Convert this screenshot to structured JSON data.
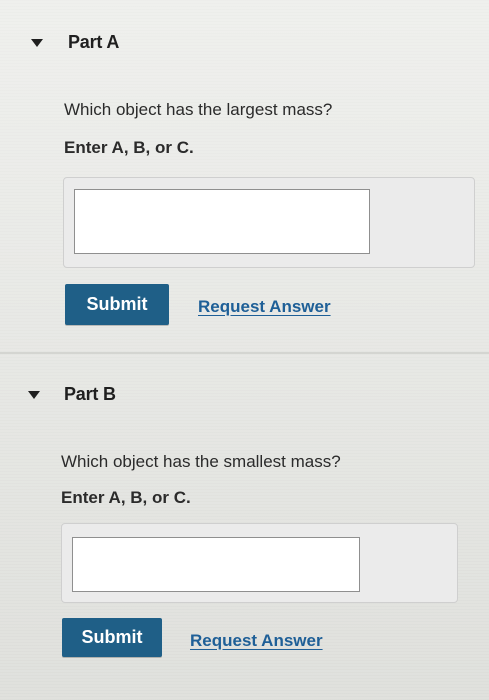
{
  "partA": {
    "title": "Part A",
    "question": "Which object has the largest mass?",
    "instruction": "Enter A, B, or C.",
    "input_value": "",
    "submit_label": "Submit",
    "request_label": "Request Answer"
  },
  "partB": {
    "title": "Part B",
    "question": "Which object has the smallest mass?",
    "instruction": "Enter A, B, or C.",
    "input_value": "",
    "submit_label": "Submit",
    "request_label": "Request Answer"
  },
  "icons": {
    "collapse": "caret-down-icon"
  },
  "colors": {
    "submit_bg": "#1f5f87",
    "link": "#1e5f97",
    "background": "#e7e8e4"
  }
}
